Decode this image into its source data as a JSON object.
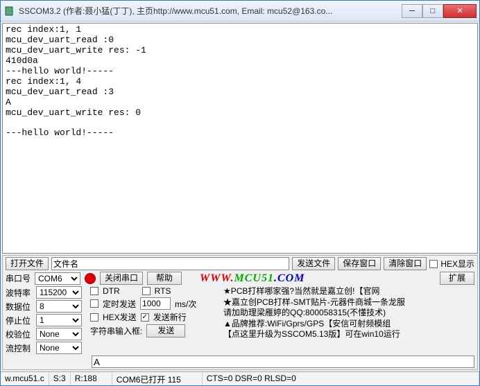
{
  "window": {
    "title": "SSCOM3.2 (作者:聂小猛(丁丁), 主页http://www.mcu51.com, Email: mcu52@163.co..."
  },
  "rx_text": "rec index:1, 1\nmcu_dev_uart_read :0\nmcu_dev_uart_write res: -1\n410d0a\n---hello world!-----\nrec index:1, 4\nmcu_dev_uart_read :3\nA\nmcu_dev_uart_write res: 0\n\n---hello world!-----\n",
  "row1": {
    "open_file": "打开文件",
    "filename": "文件名",
    "send_file": "发送文件",
    "save_window": "保存窗口",
    "clear_window": "清除窗口",
    "hex_show": "HEX显示"
  },
  "row2": {
    "port_label": "串口号",
    "port_value": "COM6",
    "close_port": "关闭串口",
    "help": "帮助",
    "url_www": "WWW.",
    "url_mcu": "MCU51",
    "url_com": ".COM",
    "expand": "扩展"
  },
  "params": {
    "baud_label": "波特率",
    "baud": "115200",
    "databits_label": "数据位",
    "databits": "8",
    "stopbits_label": "停止位",
    "stopbits": "1",
    "parity_label": "校验位",
    "parity": "None",
    "flow_label": "流控制",
    "flow": "None"
  },
  "mid": {
    "dtr": "DTR",
    "rts": "RTS",
    "timed_send": "定时发送",
    "interval": "1000",
    "ms_suffix": "ms/次",
    "hex_send": "HEX发送",
    "send_newline": "发送新行",
    "input_label": "字符串输入框:",
    "send_btn": "发送"
  },
  "ad": {
    "l1": "★PCB打样哪家强?当然就是嘉立创!【官网",
    "l2": "★嘉立创PCB打样-SMT贴片-元器件商城一条龙服",
    "l3": "请加助理梁雁婷的QQ:800058315(不懂技术)",
    "l4": "▲品牌推荐:WiFi/Gprs/GPS【安信可射频模组",
    "l5": "【点这里升级为SSCOM5.13版】可在win10运行"
  },
  "send_value": "A",
  "status": {
    "s0": "w.mcu51.c",
    "s1": "S:3",
    "s2": "R:188",
    "s3": "COM6已打开  115",
    "s4": "CTS=0 DSR=0 RLSD=0"
  }
}
